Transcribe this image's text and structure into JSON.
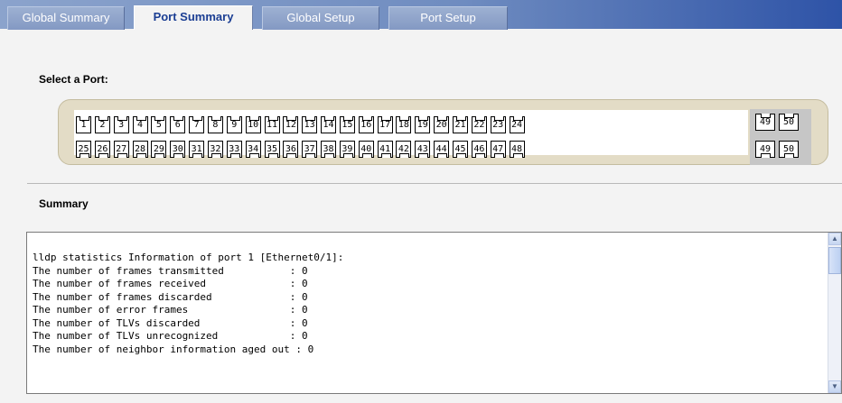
{
  "tabs": [
    {
      "label": "Global Summary",
      "active": false
    },
    {
      "label": "Port Summary",
      "active": true
    },
    {
      "label": "Global Setup",
      "active": false
    },
    {
      "label": "Port Setup",
      "active": false
    }
  ],
  "select_port": {
    "label": "Select a Port:",
    "selected_port": "1",
    "rows": [
      [
        "1",
        "2",
        "3",
        "4",
        "5",
        "6",
        "7",
        "8",
        "9",
        "10",
        "11",
        "12",
        "13",
        "14",
        "15",
        "16",
        "17",
        "18",
        "19",
        "20",
        "21",
        "22",
        "23",
        "24"
      ],
      [
        "25",
        "26",
        "27",
        "28",
        "29",
        "30",
        "31",
        "32",
        "33",
        "34",
        "35",
        "36",
        "37",
        "38",
        "39",
        "40",
        "41",
        "42",
        "43",
        "44",
        "45",
        "46",
        "47",
        "48"
      ]
    ],
    "extra_ports_top": [
      "49",
      "50"
    ],
    "extra_ports_bottom": [
      "49",
      "50"
    ]
  },
  "summary": {
    "label": "Summary",
    "lines": [
      "lldp statistics Information of port 1 [Ethernet0/1]:",
      "The number of frames transmitted           : 0",
      "The number of frames received              : 0",
      "The number of frames discarded             : 0",
      "The number of error frames                 : 0",
      "The number of TLVs discarded               : 0",
      "The number of TLVs unrecognized            : 0",
      "The number of neighbor information aged out : 0"
    ]
  },
  "icons": {
    "scroll_up": "chevron-up-icon",
    "scroll_down": "chevron-down-icon"
  },
  "colors": {
    "tab_active_text": "#1b3e93",
    "selected_port": "#1f5fc8",
    "port_panel": "#e3dcc6"
  }
}
